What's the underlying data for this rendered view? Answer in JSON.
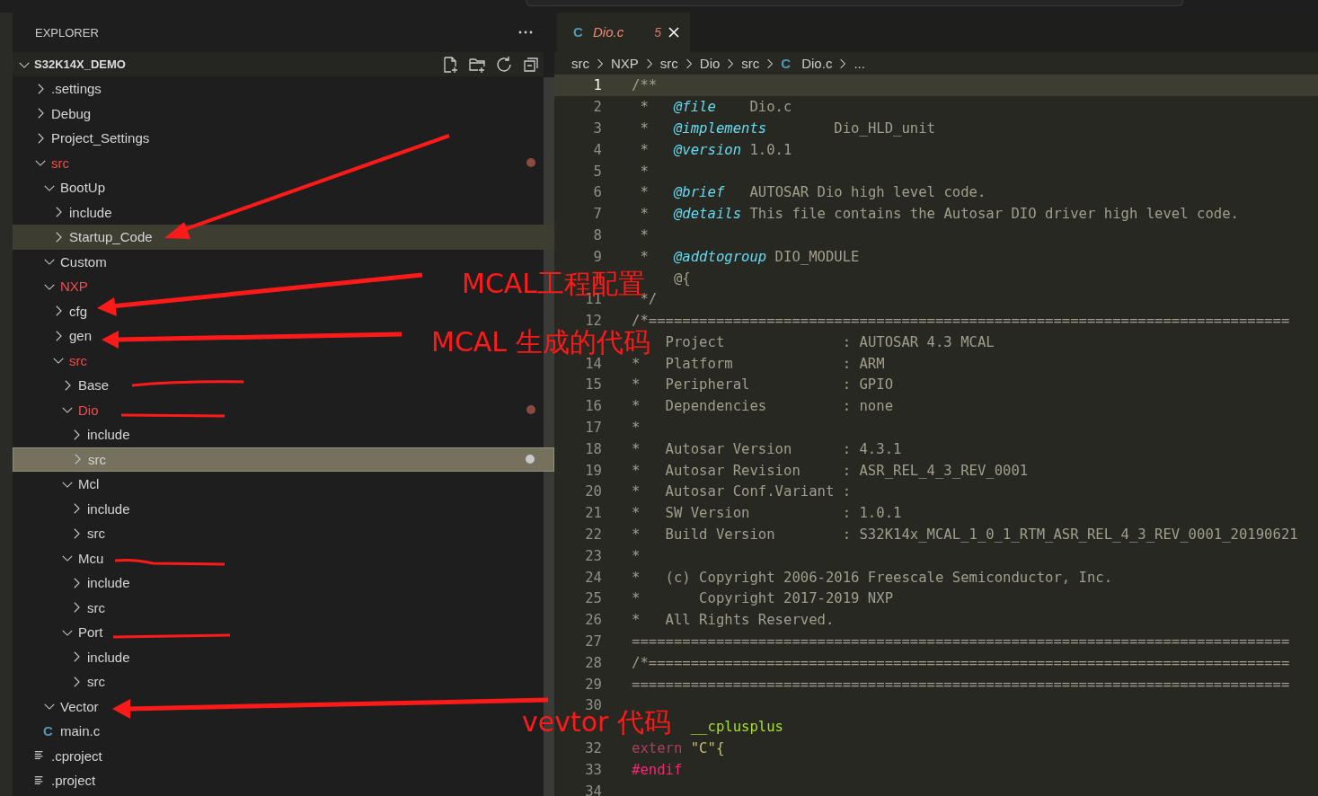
{
  "explorer": {
    "title": "EXPLORER",
    "root": {
      "label": "S32K14X_DEMO",
      "expanded": true,
      "children": [
        {
          "label": ".settings",
          "kind": "folder",
          "expanded": false,
          "modified": false,
          "dot": false,
          "selected": false,
          "hovered": false
        },
        {
          "label": "Debug",
          "kind": "folder",
          "expanded": false,
          "modified": false,
          "dot": false,
          "selected": false,
          "hovered": false
        },
        {
          "label": "Project_Settings",
          "kind": "folder",
          "expanded": false,
          "modified": false,
          "dot": false,
          "selected": false,
          "hovered": false
        },
        {
          "label": "src",
          "kind": "folder",
          "expanded": true,
          "modified": true,
          "dot": true,
          "selected": false,
          "hovered": false,
          "children": [
            {
              "label": "BootUp",
              "kind": "folder",
              "expanded": true,
              "modified": false,
              "dot": false,
              "selected": false,
              "hovered": false,
              "children": [
                {
                  "label": "include",
                  "kind": "folder",
                  "expanded": false,
                  "modified": false,
                  "dot": false,
                  "selected": false,
                  "hovered": false
                },
                {
                  "label": "Startup_Code",
                  "kind": "folder",
                  "expanded": false,
                  "modified": false,
                  "dot": false,
                  "selected": false,
                  "hovered": true
                }
              ]
            },
            {
              "label": "Custom",
              "kind": "folder",
              "expanded": true,
              "modified": false,
              "dot": false,
              "selected": false,
              "hovered": false
            },
            {
              "label": "NXP",
              "kind": "folder",
              "expanded": true,
              "modified": true,
              "dot": false,
              "selected": false,
              "hovered": false,
              "children": [
                {
                  "label": "cfg",
                  "kind": "folder",
                  "expanded": false,
                  "modified": false,
                  "dot": false,
                  "selected": false,
                  "hovered": false
                },
                {
                  "label": "gen",
                  "kind": "folder",
                  "expanded": false,
                  "modified": false,
                  "dot": false,
                  "selected": false,
                  "hovered": false
                },
                {
                  "label": "src",
                  "kind": "folder",
                  "expanded": true,
                  "modified": true,
                  "dot": false,
                  "selected": false,
                  "hovered": false,
                  "children": [
                    {
                      "label": "Base",
                      "kind": "folder",
                      "expanded": false,
                      "modified": false,
                      "dot": false,
                      "selected": false,
                      "hovered": false
                    },
                    {
                      "label": "Dio",
                      "kind": "folder",
                      "expanded": true,
                      "modified": true,
                      "dot": true,
                      "selected": false,
                      "hovered": false,
                      "children": [
                        {
                          "label": "include",
                          "kind": "folder",
                          "expanded": false,
                          "modified": false,
                          "dot": false,
                          "selected": false,
                          "hovered": false
                        },
                        {
                          "label": "src",
                          "kind": "folder",
                          "expanded": false,
                          "modified": false,
                          "dot": true,
                          "selected": true,
                          "hovered": false
                        }
                      ]
                    },
                    {
                      "label": "Mcl",
                      "kind": "folder",
                      "expanded": true,
                      "modified": false,
                      "dot": false,
                      "selected": false,
                      "hovered": false,
                      "children": [
                        {
                          "label": "include",
                          "kind": "folder",
                          "expanded": false,
                          "modified": false,
                          "dot": false,
                          "selected": false,
                          "hovered": false
                        },
                        {
                          "label": "src",
                          "kind": "folder",
                          "expanded": false,
                          "modified": false,
                          "dot": false,
                          "selected": false,
                          "hovered": false
                        }
                      ]
                    },
                    {
                      "label": "Mcu",
                      "kind": "folder",
                      "expanded": true,
                      "modified": false,
                      "dot": false,
                      "selected": false,
                      "hovered": false,
                      "children": [
                        {
                          "label": "include",
                          "kind": "folder",
                          "expanded": false,
                          "modified": false,
                          "dot": false,
                          "selected": false,
                          "hovered": false
                        },
                        {
                          "label": "src",
                          "kind": "folder",
                          "expanded": false,
                          "modified": false,
                          "dot": false,
                          "selected": false,
                          "hovered": false
                        }
                      ]
                    },
                    {
                      "label": "Port",
                      "kind": "folder",
                      "expanded": true,
                      "modified": false,
                      "dot": false,
                      "selected": false,
                      "hovered": false,
                      "children": [
                        {
                          "label": "include",
                          "kind": "folder",
                          "expanded": false,
                          "modified": false,
                          "dot": false,
                          "selected": false,
                          "hovered": false
                        },
                        {
                          "label": "src",
                          "kind": "folder",
                          "expanded": false,
                          "modified": false,
                          "dot": false,
                          "selected": false,
                          "hovered": false
                        }
                      ]
                    }
                  ]
                }
              ]
            },
            {
              "label": "Vector",
              "kind": "folder",
              "expanded": true,
              "modified": false,
              "dot": false,
              "selected": false,
              "hovered": false
            },
            {
              "label": "main.c",
              "kind": "c",
              "icon": "C",
              "modified": false,
              "dot": false,
              "selected": false,
              "hovered": false
            }
          ]
        },
        {
          "label": ".cproject",
          "kind": "text",
          "modified": false,
          "dot": false,
          "selected": false,
          "hovered": false
        },
        {
          "label": ".project",
          "kind": "text",
          "modified": false,
          "dot": false,
          "selected": false,
          "hovered": false
        }
      ]
    }
  },
  "tabs": [
    {
      "icon": "C",
      "label": "Dio.c",
      "problems": "5",
      "selected": true
    }
  ],
  "breadcrumbs": [
    {
      "label": "src"
    },
    {
      "label": "NXP"
    },
    {
      "label": "src"
    },
    {
      "label": "Dio"
    },
    {
      "label": "src"
    },
    {
      "label": "Dio.c",
      "icon": "C"
    },
    {
      "label": "..."
    }
  ],
  "code": [
    {
      "number": "1",
      "current": true,
      "tokens": [
        {
          "kind": "comment",
          "text": "/**"
        }
      ]
    },
    {
      "number": "2",
      "current": false,
      "tokens": [
        {
          "kind": "comment",
          "text": " *   "
        },
        {
          "kind": "tag",
          "text": "@file"
        },
        {
          "kind": "comment",
          "text": "    Dio.c"
        }
      ]
    },
    {
      "number": "3",
      "current": false,
      "tokens": [
        {
          "kind": "comment",
          "text": " *   "
        },
        {
          "kind": "tag",
          "text": "@implements"
        },
        {
          "kind": "comment",
          "text": "        Dio_HLD_unit"
        }
      ]
    },
    {
      "number": "4",
      "current": false,
      "tokens": [
        {
          "kind": "comment",
          "text": " *   "
        },
        {
          "kind": "tag",
          "text": "@version"
        },
        {
          "kind": "comment",
          "text": " 1.0.1"
        }
      ]
    },
    {
      "number": "5",
      "current": false,
      "tokens": [
        {
          "kind": "comment",
          "text": " *"
        }
      ]
    },
    {
      "number": "6",
      "current": false,
      "tokens": [
        {
          "kind": "comment",
          "text": " *   "
        },
        {
          "kind": "tag",
          "text": "@brief"
        },
        {
          "kind": "comment",
          "text": "   AUTOSAR Dio high level code."
        }
      ]
    },
    {
      "number": "7",
      "current": false,
      "tokens": [
        {
          "kind": "comment",
          "text": " *   "
        },
        {
          "kind": "tag",
          "text": "@details"
        },
        {
          "kind": "comment",
          "text": " This file contains the Autosar DIO driver high level code."
        }
      ]
    },
    {
      "number": "8",
      "current": false,
      "tokens": [
        {
          "kind": "comment",
          "text": " *"
        }
      ]
    },
    {
      "number": "9",
      "current": false,
      "tokens": [
        {
          "kind": "comment",
          "text": " *   "
        },
        {
          "kind": "tag",
          "text": "@addtogroup"
        },
        {
          "kind": "comment",
          "text": " DIO_MODULE"
        }
      ]
    },
    {
      "current": false,
      "tokens": [
        {
          "kind": "comment",
          "text": "     @{"
        }
      ]
    },
    {
      "number": "11",
      "current": false,
      "tokens": [
        {
          "kind": "comment",
          "text": " */"
        }
      ]
    },
    {
      "number": "12",
      "current": false,
      "tokens": [
        {
          "kind": "comment",
          "text": "/*============================================================================"
        }
      ]
    },
    {
      "current": false,
      "tokens": [
        {
          "kind": "comment",
          "text": "    Project              : AUTOSAR 4.3 MCAL"
        }
      ]
    },
    {
      "number": "14",
      "current": false,
      "tokens": [
        {
          "kind": "comment",
          "text": "*   Platform             : ARM"
        }
      ]
    },
    {
      "number": "15",
      "current": false,
      "tokens": [
        {
          "kind": "comment",
          "text": "*   Peripheral           : GPIO"
        }
      ]
    },
    {
      "number": "16",
      "current": false,
      "tokens": [
        {
          "kind": "comment",
          "text": "*   Dependencies         : none"
        }
      ]
    },
    {
      "number": "17",
      "current": false,
      "tokens": [
        {
          "kind": "comment",
          "text": "*"
        }
      ]
    },
    {
      "number": "18",
      "current": false,
      "tokens": [
        {
          "kind": "comment",
          "text": "*   Autosar Version      : 4.3.1"
        }
      ]
    },
    {
      "number": "19",
      "current": false,
      "tokens": [
        {
          "kind": "comment",
          "text": "*   Autosar Revision     : ASR_REL_4_3_REV_0001"
        }
      ]
    },
    {
      "number": "20",
      "current": false,
      "tokens": [
        {
          "kind": "comment",
          "text": "*   Autosar Conf.Variant :"
        }
      ]
    },
    {
      "number": "21",
      "current": false,
      "tokens": [
        {
          "kind": "comment",
          "text": "*   SW Version           : 1.0.1"
        }
      ]
    },
    {
      "number": "22",
      "current": false,
      "tokens": [
        {
          "kind": "comment",
          "text": "*   Build Version        : S32K14x_MCAL_1_0_1_RTM_ASR_REL_4_3_REV_0001_20190621"
        }
      ]
    },
    {
      "number": "23",
      "current": false,
      "tokens": [
        {
          "kind": "comment",
          "text": "*"
        }
      ]
    },
    {
      "number": "24",
      "current": false,
      "tokens": [
        {
          "kind": "comment",
          "text": "*   (c) Copyright 2006-2016 Freescale Semiconductor, Inc."
        }
      ]
    },
    {
      "number": "25",
      "current": false,
      "tokens": [
        {
          "kind": "comment",
          "text": "*       Copyright 2017-2019 NXP"
        }
      ]
    },
    {
      "number": "26",
      "current": false,
      "tokens": [
        {
          "kind": "comment",
          "text": "*   All Rights Reserved."
        }
      ]
    },
    {
      "number": "27",
      "current": false,
      "tokens": [
        {
          "kind": "comment",
          "text": "=============================================================================="
        }
      ]
    },
    {
      "number": "28",
      "current": false,
      "tokens": [
        {
          "kind": "comment",
          "text": "/*============================================================================"
        }
      ]
    },
    {
      "number": "29",
      "current": false,
      "tokens": [
        {
          "kind": "comment",
          "text": "=============================================================================="
        }
      ]
    },
    {
      "number": "30",
      "current": false
    },
    {
      "current": false,
      "tokens": [
        {
          "kind": "macro",
          "text": "       __cplusplus"
        }
      ]
    },
    {
      "number": "32",
      "current": false,
      "tokens": [
        {
          "kind": "keyword",
          "text": "extern"
        },
        {
          "kind": "string",
          "text": "\"C\"{"
        }
      ]
    },
    {
      "number": "33",
      "current": false,
      "tokens": [
        {
          "kind": "preproc",
          "text": "#endif"
        }
      ]
    },
    {
      "number": "34",
      "current": false
    }
  ],
  "annotations": [
    {
      "text": "MCAL工程配置"
    },
    {
      "text": "MCAL 生成的代码"
    },
    {
      "text": "vevtor 代码"
    }
  ]
}
